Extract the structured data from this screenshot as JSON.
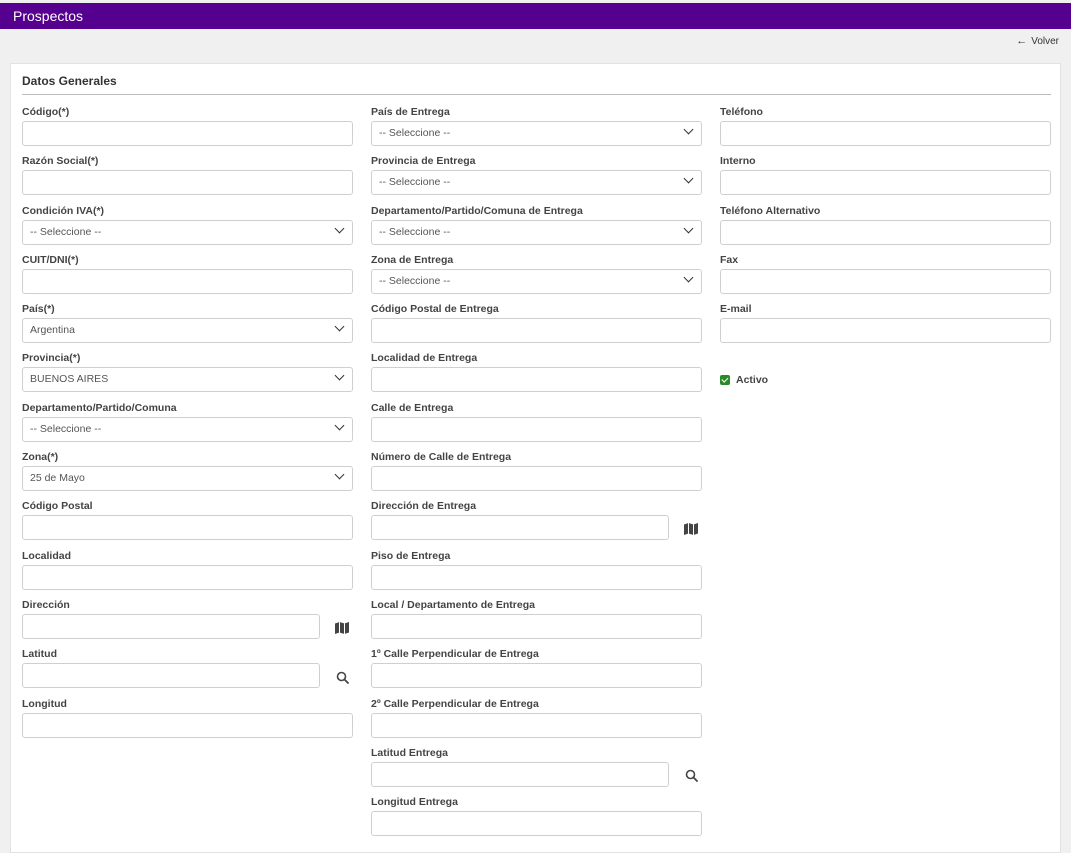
{
  "header": {
    "title": "Prospectos"
  },
  "nav": {
    "back_label": "Volver",
    "back_arrow": "←"
  },
  "section": {
    "title": "Datos Generales"
  },
  "form": {
    "col1": {
      "codigo": {
        "label": "Código(*)",
        "value": ""
      },
      "razon_social": {
        "label": "Razón Social(*)",
        "value": ""
      },
      "condicion_iva": {
        "label": "Condición IVA(*)",
        "value": "-- Seleccione --"
      },
      "cuit_dni": {
        "label": "CUIT/DNI(*)",
        "value": ""
      },
      "pais": {
        "label": "País(*)",
        "value": "Argentina"
      },
      "provincia": {
        "label": "Provincia(*)",
        "value": "BUENOS AIRES"
      },
      "departamento": {
        "label": "Departamento/Partido/Comuna",
        "value": "-- Seleccione --"
      },
      "zona": {
        "label": "Zona(*)",
        "value": "25 de Mayo"
      },
      "codigo_postal": {
        "label": "Código Postal",
        "value": ""
      },
      "localidad": {
        "label": "Localidad",
        "value": ""
      },
      "direccion": {
        "label": "Dirección",
        "value": ""
      },
      "latitud": {
        "label": "Latitud",
        "value": ""
      },
      "longitud": {
        "label": "Longitud",
        "value": ""
      }
    },
    "col2": {
      "pais_entrega": {
        "label": "País de Entrega",
        "value": "-- Seleccione --"
      },
      "provincia_entrega": {
        "label": "Provincia de Entrega",
        "value": "-- Seleccione --"
      },
      "departamento_entrega": {
        "label": "Departamento/Partido/Comuna de Entrega",
        "value": "-- Seleccione --"
      },
      "zona_entrega": {
        "label": "Zona de Entrega",
        "value": "-- Seleccione --"
      },
      "codigo_postal_entrega": {
        "label": "Código Postal de Entrega",
        "value": ""
      },
      "localidad_entrega": {
        "label": "Localidad de Entrega",
        "value": ""
      },
      "calle_entrega": {
        "label": "Calle de Entrega",
        "value": ""
      },
      "numero_calle_entrega": {
        "label": "Número de Calle de Entrega",
        "value": ""
      },
      "direccion_entrega": {
        "label": "Dirección de Entrega",
        "value": ""
      },
      "piso_entrega": {
        "label": "Piso de Entrega",
        "value": ""
      },
      "local_departamento_entrega": {
        "label": "Local / Departamento de Entrega",
        "value": ""
      },
      "calle_perp1_entrega": {
        "label": "1º Calle Perpendicular de Entrega",
        "value": ""
      },
      "calle_perp2_entrega": {
        "label": "2º Calle Perpendicular de Entrega",
        "value": ""
      },
      "latitud_entrega": {
        "label": "Latitud Entrega",
        "value": ""
      },
      "longitud_entrega": {
        "label": "Longitud Entrega",
        "value": ""
      }
    },
    "col3": {
      "telefono": {
        "label": "Teléfono",
        "value": ""
      },
      "interno": {
        "label": "Interno",
        "value": ""
      },
      "telefono_alternativo": {
        "label": "Teléfono Alternativo",
        "value": ""
      },
      "fax": {
        "label": "Fax",
        "value": ""
      },
      "email": {
        "label": "E-mail",
        "value": ""
      },
      "activo": {
        "label": "Activo",
        "checked": true
      }
    }
  },
  "colors": {
    "header_bg": "#55008f",
    "checkbox": "#2a8a2a"
  },
  "icons": {
    "map": "map-icon",
    "search": "search-icon",
    "back": "arrow-left-icon",
    "chevron": "chevron-down-icon"
  }
}
